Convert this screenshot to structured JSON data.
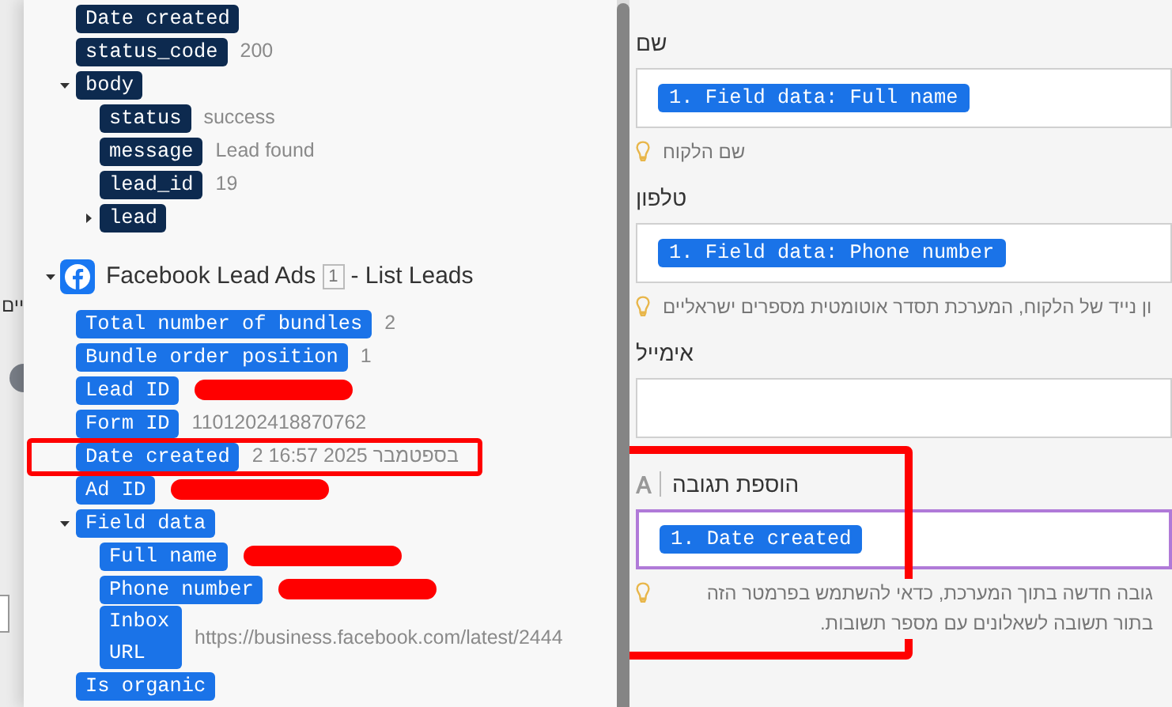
{
  "background_strip": {
    "fragment": "יים"
  },
  "output_tree": {
    "sections": [
      {
        "kind": "plain",
        "items": [
          {
            "key": "Date created"
          },
          {
            "key": "status_code",
            "value": "200"
          },
          {
            "key": "body",
            "expanded": true,
            "children": [
              {
                "key": "status",
                "value": "success"
              },
              {
                "key": "message",
                "value": "Lead found"
              },
              {
                "key": "lead_id",
                "value": "19"
              },
              {
                "key": "lead",
                "expanded": false
              }
            ]
          }
        ]
      },
      {
        "kind": "module",
        "title": "Facebook Lead Ads",
        "index": "1",
        "subtitle": "- List Leads",
        "expanded": true,
        "items": [
          {
            "key": "Total number of bundles",
            "value": "2"
          },
          {
            "key": "Bundle order position",
            "value": "1"
          },
          {
            "key": "Lead ID",
            "redacted": true
          },
          {
            "key": "Form ID",
            "value": "1101202418870762"
          },
          {
            "key": "Date created",
            "value": "2 16:57 2025 בספטמבר",
            "highlighted": true
          },
          {
            "key": "Ad ID",
            "redacted": true
          },
          {
            "key": "Field data",
            "expanded": true,
            "children": [
              {
                "key": "Full name",
                "redacted": true
              },
              {
                "key": "Phone number",
                "redacted": true
              },
              {
                "key": "Inbox URL",
                "value": "https://business.facebook.com/latest/2444"
              }
            ]
          },
          {
            "key": "Is organic"
          }
        ]
      }
    ]
  },
  "mapping_form": {
    "fields": [
      {
        "kind": "plain",
        "label": "שם",
        "tokens": [
          "1. Field data: Full name"
        ],
        "hint": "שם הלקוח",
        "focused": false
      },
      {
        "kind": "plain",
        "label": "טלפון",
        "tokens": [
          "1. Field data: Phone number"
        ],
        "hint": "ון נייד של הלקוח, המערכת תסדר אוטומטית מספרים ישראליים",
        "focused": false
      },
      {
        "kind": "plain",
        "label": "אימייל",
        "focused": false
      },
      {
        "kind": "text",
        "label": "הוספת תגובה",
        "tokens": [
          "1. Date created"
        ],
        "hint": "גובה חדשה בתוך המערכת, כדאי להשתמש בפרמטר הזה בתור תשובה לשאלונים עם מספר תשובות.",
        "focused": true,
        "highlighted": true
      }
    ]
  }
}
